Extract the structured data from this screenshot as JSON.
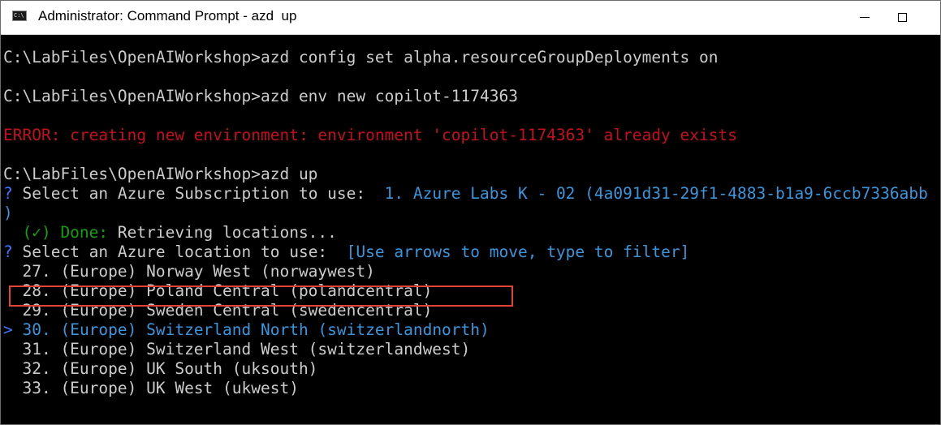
{
  "window": {
    "title": "Administrator: Command Prompt - azd  up",
    "icon": "cmd-icon"
  },
  "console": {
    "lines": [
      {
        "prompt": "C:\\LabFiles\\OpenAIWorkshop>",
        "command": "azd config set alpha.resourceGroupDeployments on"
      },
      {
        "prompt": "C:\\LabFiles\\OpenAIWorkshop>",
        "command": "azd env new copilot-1174363"
      },
      {
        "text": "ERROR: creating new environment: environment 'copilot-1174363' already exists"
      },
      {
        "prompt": "C:\\LabFiles\\OpenAIWorkshop>",
        "command": "azd up"
      },
      {
        "marker": "?",
        "label": " Select an Azure Subscription to use:  ",
        "value": "1. Azure Labs K - 02 (4a091d31-29f1-4883-b1a9-6ccb7336abb"
      },
      {
        "text": ")"
      },
      {
        "check": "  (✓) Done:",
        "text": " Retrieving locations..."
      },
      {
        "marker": "?",
        "label": " Select an Azure location to use:  ",
        "value": "[Use arrows to move, type to filter]"
      }
    ],
    "options": [
      {
        "label": "27. (Europe) Norway West (norwaywest)"
      },
      {
        "label": "28. (Europe) Poland Central (polandcentral)"
      },
      {
        "label": "29. (Europe) Sweden Central (swedencentral)"
      },
      {
        "label": "30. (Europe) Switzerland North (switzerlandnorth)",
        "selected": true,
        "cursor": ">"
      },
      {
        "label": "31. (Europe) Switzerland West (switzerlandwest)"
      },
      {
        "label": "32. (Europe) UK South (uksouth)"
      },
      {
        "label": "33. (Europe) UK West (ukwest)"
      }
    ]
  },
  "colors": {
    "background": "#000000",
    "text": "#cccccc",
    "error": "#c50f1f",
    "success": "#13a10e",
    "prompt_marker": "#3b78ff",
    "selected": "#3a96dd",
    "highlight_border": "#e34234"
  }
}
